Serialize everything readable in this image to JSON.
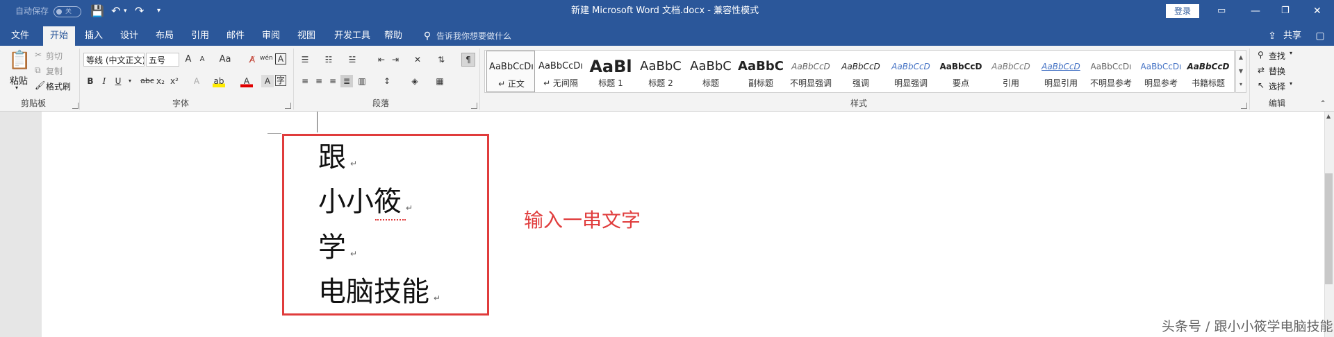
{
  "titlebar": {
    "autosave_label": "自动保存",
    "autosave_state": "关",
    "title": "新建 Microsoft Word 文档.docx  -  兼容性模式",
    "login_label": "登录",
    "save_icon": "save-icon",
    "undo_icon": "undo-icon",
    "redo_icon": "redo-icon"
  },
  "tabs": [
    "文件",
    "开始",
    "插入",
    "设计",
    "布局",
    "引用",
    "邮件",
    "审阅",
    "视图",
    "开发工具",
    "帮助"
  ],
  "active_tab": "开始",
  "tell_me": "告诉我你想要做什么",
  "share_label": "共享",
  "clipboard": {
    "paste": "粘贴",
    "cut": "剪切",
    "copy": "复制",
    "format_painter": "格式刷",
    "group": "剪贴板"
  },
  "font": {
    "font_name": "等线 (中文正文)",
    "font_size": "五号",
    "group": "字体",
    "bold": "B",
    "italic": "I",
    "underline": "U",
    "strike": "abc",
    "sub": "x₂",
    "sup": "x²",
    "change_case": "Aa",
    "grow": "A",
    "shrink": "A",
    "phonetic": "wén",
    "border_char": "A"
  },
  "paragraph": {
    "group": "段落"
  },
  "styles": {
    "group": "样式",
    "items": [
      {
        "preview": "AaBbCcDı",
        "name": "↵ 正文"
      },
      {
        "preview": "AaBbCcDı",
        "name": "↵ 无间隔"
      },
      {
        "preview": "AaBl",
        "name": "标题 1"
      },
      {
        "preview": "AaBbC",
        "name": "标题 2"
      },
      {
        "preview": "AaBbC",
        "name": "标题"
      },
      {
        "preview": "AaBbC",
        "name": "副标题"
      },
      {
        "preview": "AaBbCcD",
        "name": "不明显强调"
      },
      {
        "preview": "AaBbCcD",
        "name": "强调"
      },
      {
        "preview": "AaBbCcD",
        "name": "明显强调"
      },
      {
        "preview": "AaBbCcD",
        "name": "要点"
      },
      {
        "preview": "AaBbCcD",
        "name": "引用"
      },
      {
        "preview": "AaBbCcD",
        "name": "明显引用"
      },
      {
        "preview": "AaBbCcDı",
        "name": "不明显参考"
      },
      {
        "preview": "AaBbCcDı",
        "name": "明显参考"
      },
      {
        "preview": "AaBbCcD",
        "name": "书籍标题"
      }
    ]
  },
  "editing": {
    "find": "查找",
    "replace": "替换",
    "select": "选择",
    "group": "编辑"
  },
  "document": {
    "lines": [
      "跟",
      "小小筱",
      "学",
      "电脑技能"
    ],
    "paragraph_mark": "↵",
    "annotation": "输入一串文字"
  },
  "watermark": "头条号 / 跟小小筱学电脑技能",
  "colors": {
    "accent": "#2b579a",
    "annotation_red": "#e03c3c"
  }
}
